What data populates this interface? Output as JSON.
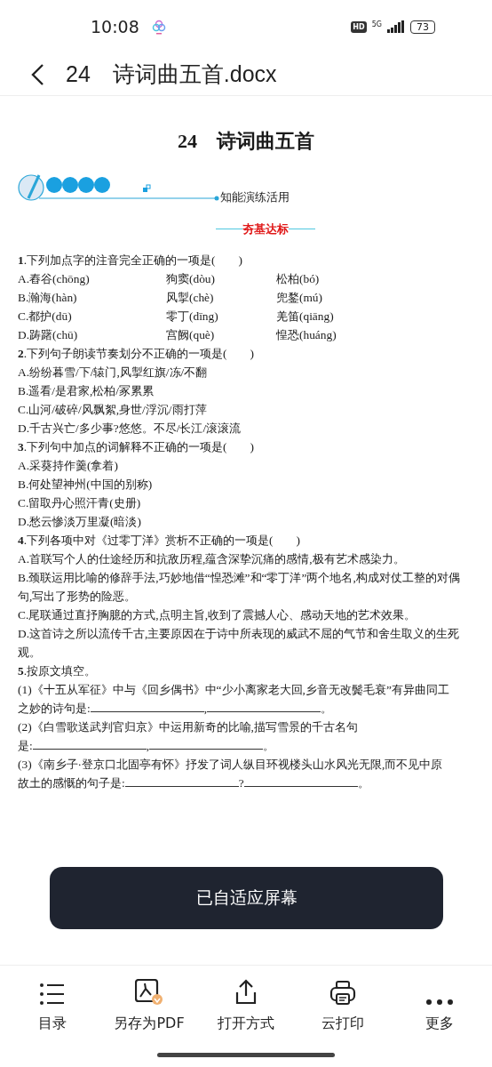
{
  "status_bar": {
    "time": "10:08",
    "hd": "HD",
    "network": "5G",
    "battery": "73"
  },
  "header": {
    "title": "24　诗词曲五首.docx"
  },
  "document": {
    "title": "24　诗词曲五首",
    "section": "知能演练活用",
    "subheading": "夯基达标",
    "questions": [
      {
        "stem": "**1**.下列加点字的注音完全正确的一项是(　　)",
        "option_rows": [
          [
            "A.舂谷(chōng)",
            "狗窦(dòu)",
            "松柏(bó)"
          ],
          [
            "B.瀚海(hàn)",
            "风掣(chè)",
            "兜鍪(mú)"
          ],
          [
            "C.都护(dū)",
            "零丁(dīng)",
            "羌笛(qiāng)"
          ],
          [
            "D.踌躇(chū)",
            "宫阙(què)",
            "惶恐(huáng)"
          ]
        ]
      },
      {
        "stem": "**2**.下列句子朗读节奏划分不正确的一项是(　　)",
        "options": [
          "A.纷纷暮雪/下/辕门,风掣红旗/冻/不翻",
          "B.遥看/是君家,松柏/冢累累",
          "C.山河/破碎/风飘絮,身世/浮沉/雨打萍",
          "D.千古兴亡/多少事?悠悠。不尽/长江/滚滚流"
        ]
      },
      {
        "stem": "**3**.下列句中加点的词解释不正确的一项是(　　)",
        "options": [
          "A.采葵持作羹(拿着)",
          "B.何处望神州(中国的别称)",
          "C.留取丹心照汗青(史册)",
          "D.愁云惨淡万里凝(暗淡)"
        ]
      },
      {
        "stem": "**4**.下列各项中对《过零丁洋》赏析不正确的一项是(　　)",
        "options": [
          "A.首联写个人的仕途经历和抗敌历程,蕴含深挚沉痛的感情,极有艺术感染力。",
          "B.颈联运用比喻的修辞手法,巧妙地借“惶恐滩”和“零丁洋”两个地名,构成对仗工整的对偶句,写出了形势的险恶。",
          "C.尾联通过直抒胸臆的方式,点明主旨,收到了震撼人心、感动天地的艺术效果。",
          "D.这首诗之所以流传千古,主要原因在于诗中所表现的威武不屈的气节和舍生取义的生死观。"
        ]
      },
      {
        "stem": "**5**.按原文填空。",
        "fill_ins": [
          {
            "lines": [
              "(1)《十五从军征》中与《回乡偶书》中“少小离家老大回,乡音无改鬓毛衰”有异曲同工",
              "之妙的诗句是:"
            ],
            "separator": ",",
            "end": "。"
          },
          {
            "lines": [
              "(2)《白雪歌送武判官归京》中运用新奇的比喻,描写雪景的千古名句",
              "是:"
            ],
            "separator": ",",
            "end": "。"
          },
          {
            "lines": [
              "(3)《南乡子·登京口北固亭有怀》抒发了词人纵目环视楼头山水风光无限,而不见中原",
              "故土的感慨的句子是:"
            ],
            "separator": "?",
            "end": "。"
          }
        ]
      }
    ]
  },
  "toast": "已自适应屏幕",
  "toolbar": [
    "目录",
    "另存为PDF",
    "打开方式",
    "云打印",
    "更多"
  ]
}
